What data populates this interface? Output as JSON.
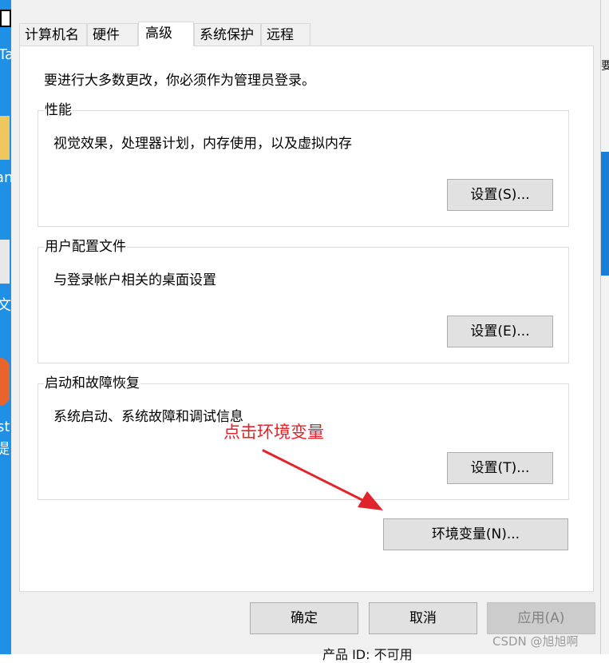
{
  "tabs": [
    "计算机名",
    "硬件",
    "高级",
    "系统保护",
    "远程"
  ],
  "admin_notice": "要进行大多数更改，你必须作为管理员登录。",
  "performance": {
    "title": "性能",
    "description": "视觉效果，处理器计划，内存使用，以及虚拟内存",
    "button": "设置(S)..."
  },
  "user_profiles": {
    "title": "用户配置文件",
    "description": "与登录帐户相关的桌面设置",
    "button": "设置(E)..."
  },
  "startup_recovery": {
    "title": "启动和故障恢复",
    "description": "系统启动、系统故障和调试信息",
    "button": "设置(T)..."
  },
  "env_button": "环境变量(N)...",
  "footer": {
    "ok": "确定",
    "cancel": "取消",
    "apply": "应用(A)"
  },
  "annotation": "点击环境变量",
  "watermark": "CSDN @旭旭啊",
  "background": {
    "left_fragments": [
      "Ta",
      "an",
      "文",
      "st",
      "提"
    ],
    "right_fragment": "要",
    "bottom_fragment": "产品 ID: 不可用"
  },
  "colors": {
    "annotation": "#e0242b",
    "desktop_blue": "#1e90e6"
  }
}
